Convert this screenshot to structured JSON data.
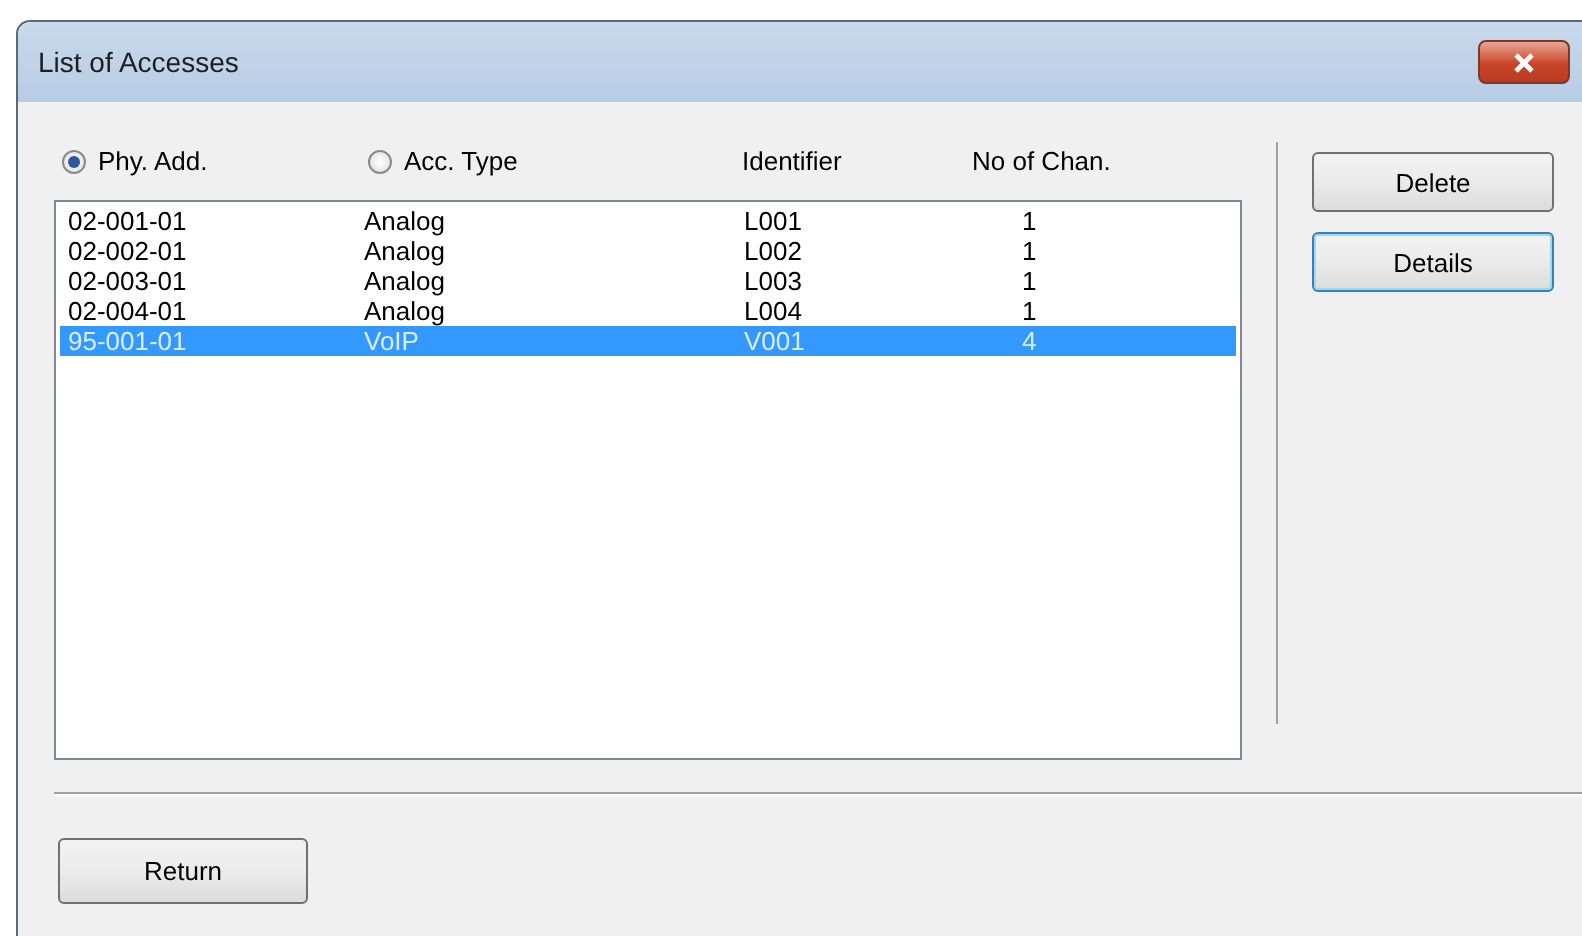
{
  "window": {
    "title": "List of Accesses"
  },
  "header": [
    {
      "kind": "radio",
      "label": "Phy. Add.",
      "selected": true
    },
    {
      "kind": "radio",
      "label": "Acc. Type",
      "selected": false
    },
    {
      "kind": "label",
      "label": "Identifier"
    },
    {
      "kind": "label",
      "label": "No of Chan."
    }
  ],
  "rows": [
    {
      "cells": [
        "02-001-01",
        "Analog",
        "L001",
        "1"
      ],
      "selected": false
    },
    {
      "cells": [
        "02-002-01",
        "Analog",
        "L002",
        "1"
      ],
      "selected": false
    },
    {
      "cells": [
        "02-003-01",
        "Analog",
        "L003",
        "1"
      ],
      "selected": false
    },
    {
      "cells": [
        "02-004-01",
        "Analog",
        "L004",
        "1"
      ],
      "selected": false
    },
    {
      "cells": [
        "95-001-01",
        "VoIP",
        "V001",
        "4"
      ],
      "selected": true
    }
  ],
  "side_buttons": [
    {
      "label": "Delete",
      "focused": false
    },
    {
      "label": "Details",
      "focused": true
    }
  ],
  "buttons": [
    "Return"
  ]
}
